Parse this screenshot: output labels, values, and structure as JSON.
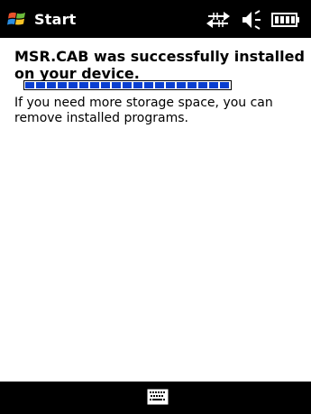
{
  "titlebar": {
    "start_label": "Start",
    "icons": [
      "windows-start-icon",
      "connectivity-icon",
      "volume-icon",
      "battery-icon"
    ]
  },
  "install": {
    "headline": "MSR.CAB was successfully installed on your device.",
    "progress_fraction": 1.0,
    "message": "If you need more storage space, you can remove installed programs."
  },
  "softbar": {
    "icons": [
      "keyboard-icon"
    ]
  },
  "colors": {
    "bar_background": "#000000",
    "page_background": "#FFFFFF",
    "progress_fill": "#0A3FD0"
  }
}
